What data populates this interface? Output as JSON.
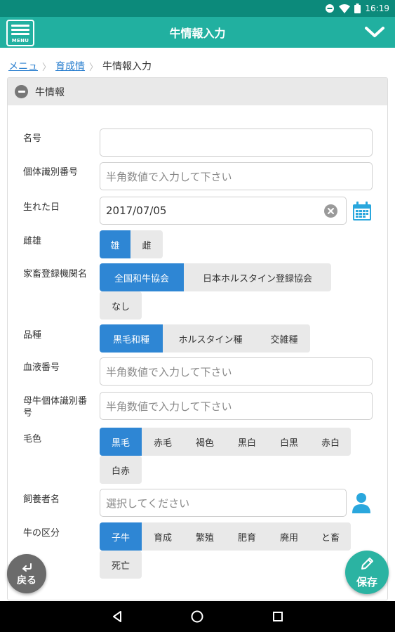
{
  "status_bar": {
    "time": "16:19"
  },
  "app_bar": {
    "title": "牛情報入力",
    "menu_label": "MENU"
  },
  "breadcrumb": {
    "items": [
      "メニュ",
      "育成情"
    ],
    "current": "牛情報入力"
  },
  "section": {
    "title": "牛情報"
  },
  "form": {
    "name": {
      "label": "名号",
      "value": ""
    },
    "id_number": {
      "label": "個体識別番号",
      "placeholder": "半角数値で入力して下さい"
    },
    "birth_date": {
      "label": "生れた日",
      "value": "2017/07/05"
    },
    "sex": {
      "label": "雌雄",
      "options": [
        "雄",
        "雌"
      ],
      "selected": "雄"
    },
    "registry": {
      "label": "家畜登録機関名",
      "options": [
        "全国和牛協会",
        "日本ホルスタイン登録協会",
        "なし"
      ],
      "selected": "全国和牛協会"
    },
    "breed": {
      "label": "品種",
      "options": [
        "黒毛和種",
        "ホルスタイン種",
        "交雑種"
      ],
      "selected": "黒毛和種"
    },
    "blood_number": {
      "label": "血液番号",
      "placeholder": "半角数値で入力して下さい"
    },
    "mother_id": {
      "label": "母牛個体識別番号",
      "placeholder": "半角数値で入力して下さい"
    },
    "coat_color": {
      "label": "毛色",
      "options": [
        "黒毛",
        "赤毛",
        "褐色",
        "黒白",
        "白黒",
        "赤白",
        "白赤"
      ],
      "selected": "黒毛"
    },
    "breeder": {
      "label": "飼養者名",
      "placeholder": "選択してください"
    },
    "category": {
      "label": "牛の区分",
      "options": [
        "子牛",
        "育成",
        "繁殖",
        "肥育",
        "廃用",
        "と畜",
        "死亡"
      ],
      "selected": "子牛"
    }
  },
  "buttons": {
    "back": "戻る",
    "save": "保存"
  },
  "colors": {
    "accent": "#21b0a0",
    "selected": "#2e86d4",
    "status_bar": "#0c8a7b"
  }
}
